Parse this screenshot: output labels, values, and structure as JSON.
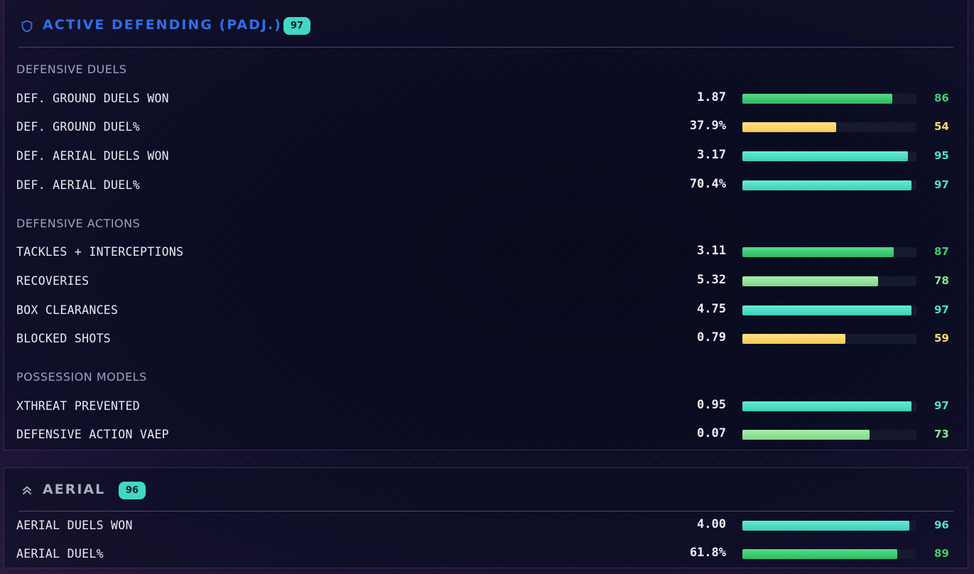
{
  "colors": {
    "teal": "#4fe0c9",
    "green": "#3ccf73",
    "lightgreen": "#8fe39a",
    "yellow": "#ffd86b",
    "title_blue": "#2f6fe8",
    "badge": "#3fd8c4"
  },
  "panels": [
    {
      "title": "ACTIVE DEFENDING (PADJ.)",
      "score": "97",
      "icon": "shield-icon",
      "sections": [
        {
          "title": "DEFENSIVE DUELS",
          "rows": [
            {
              "label": "DEF. GROUND DUELS WON",
              "value": "1.87",
              "percentile": "86",
              "percent": 86,
              "color": "green"
            },
            {
              "label": "DEF. GROUND DUEL%",
              "value": "37.9%",
              "percentile": "54",
              "percent": 54,
              "color": "yellow"
            },
            {
              "label": "DEF. AERIAL DUELS WON",
              "value": "3.17",
              "percentile": "95",
              "percent": 95,
              "color": "teal"
            },
            {
              "label": "DEF. AERIAL DUEL%",
              "value": "70.4%",
              "percentile": "97",
              "percent": 97,
              "color": "teal"
            }
          ]
        },
        {
          "title": "DEFENSIVE ACTIONS",
          "rows": [
            {
              "label": "TACKLES + INTERCEPTIONS",
              "value": "3.11",
              "percentile": "87",
              "percent": 87,
              "color": "green"
            },
            {
              "label": "RECOVERIES",
              "value": "5.32",
              "percentile": "78",
              "percent": 78,
              "color": "lightgreen"
            },
            {
              "label": "BOX CLEARANCES",
              "value": "4.75",
              "percentile": "97",
              "percent": 97,
              "color": "teal"
            },
            {
              "label": "BLOCKED SHOTS",
              "value": "0.79",
              "percentile": "59",
              "percent": 59,
              "color": "yellow"
            }
          ]
        },
        {
          "title": "POSSESSION MODELS",
          "rows": [
            {
              "label": "XTHREAT PREVENTED",
              "value": "0.95",
              "percentile": "97",
              "percent": 97,
              "color": "teal"
            },
            {
              "label": "DEFENSIVE ACTION VAEP",
              "value": "0.07",
              "percentile": "73",
              "percent": 73,
              "color": "lightgreen"
            }
          ]
        }
      ]
    },
    {
      "title": "AERIAL",
      "score": "96",
      "icon": "chevrons-up-icon",
      "sections": [
        {
          "title": "",
          "rows": [
            {
              "label": "AERIAL DUELS WON",
              "value": "4.00",
              "percentile": "96",
              "percent": 96,
              "color": "teal"
            },
            {
              "label": "AERIAL DUEL%",
              "value": "61.8%",
              "percentile": "89",
              "percent": 89,
              "color": "green"
            }
          ]
        }
      ]
    }
  ]
}
